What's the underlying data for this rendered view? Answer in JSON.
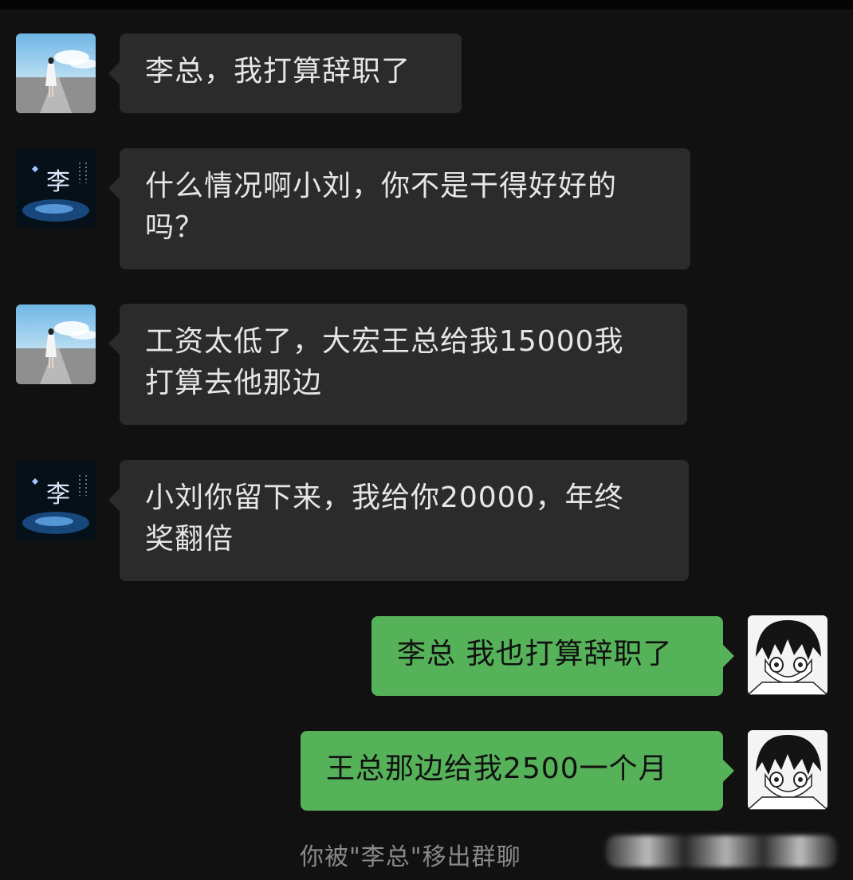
{
  "messages": [
    {
      "side": "left",
      "sender": "boss-li",
      "text": "李总，我打算辞职了"
    },
    {
      "side": "left",
      "sender": "boss-li",
      "text": "什么情况啊小刘，你不是干得好好的\n吗？"
    },
    {
      "side": "left",
      "sender": "xiao-liu",
      "text": "工资太低了，大宏王总给我15000我\n打算去他那边"
    },
    {
      "side": "left",
      "sender": "boss-li",
      "text": "小刘你留下来，我给你20000，年终\n奖翻倍"
    },
    {
      "side": "right",
      "sender": "me",
      "text": "李总 我也打算辞职了"
    },
    {
      "side": "right",
      "sender": "me",
      "text": "王总那边给我2500一个月"
    }
  ],
  "system_note": "你被\"李总\"移出群聊",
  "avatars": {
    "li_char": "李"
  },
  "colors": {
    "background": "#111111",
    "left_bubble": "#2b2b2b",
    "right_bubble": "#55b259",
    "left_text": "#e6e6e6",
    "right_text": "#111111"
  }
}
